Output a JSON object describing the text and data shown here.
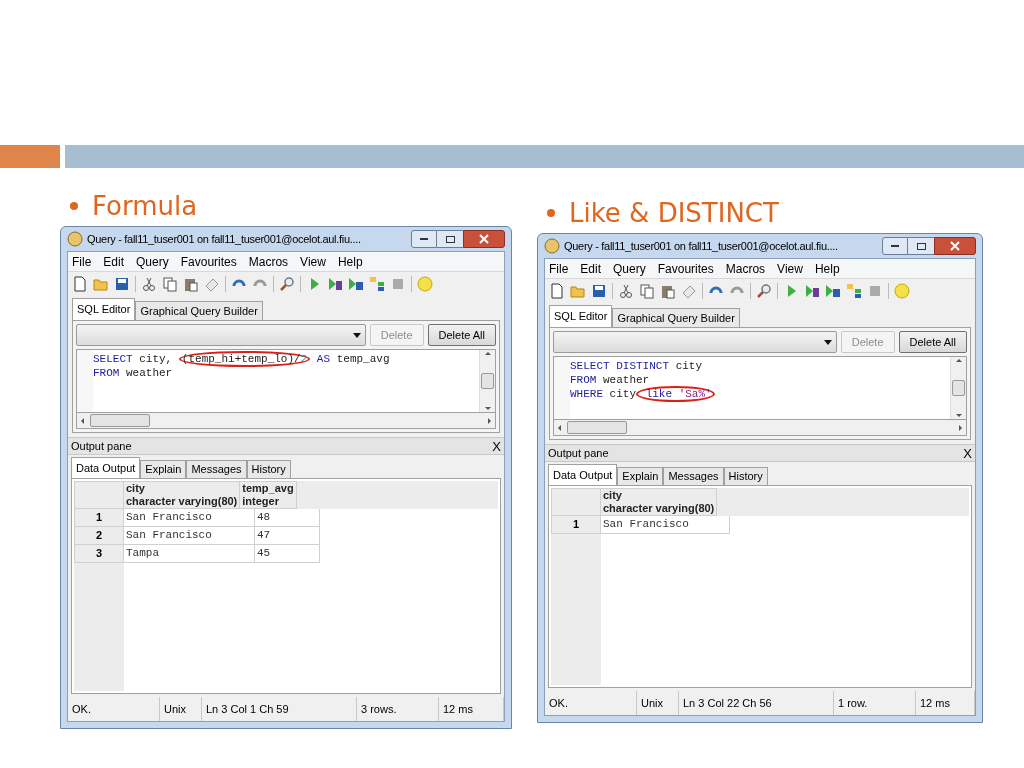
{
  "slide": {
    "panels": [
      {
        "bullet": "Formula",
        "window": {
          "title": "Query - fall11_tuser001 on fall11_tuser001@ocelot.aul.fiu....",
          "menu": [
            "File",
            "Edit",
            "Query",
            "Favourites",
            "Macros",
            "View",
            "Help"
          ],
          "editor_tabs": [
            {
              "label": "SQL Editor",
              "selected": true
            },
            {
              "label": "Graphical Query Builder",
              "selected": false
            }
          ],
          "buttons": [
            {
              "label": "Delete",
              "disabled": true
            },
            {
              "label": "Delete All",
              "disabled": false
            }
          ],
          "sql": [
            [
              {
                "text": "SELECT",
                "kind": "keyword"
              },
              {
                "text": " city, ",
                "kind": "plain"
              },
              {
                "text": "(temp_hi+temp_lo)/",
                "kind": "plain",
                "circled": true
              },
              {
                "text": "2",
                "kind": "number",
                "circled": true
              },
              {
                "text": " AS",
                "kind": "keyword"
              },
              {
                "text": " temp_avg",
                "kind": "plain"
              }
            ],
            [
              {
                "text": "FROM",
                "kind": "keyword"
              },
              {
                "text": " weather",
                "kind": "plain"
              }
            ]
          ],
          "output": {
            "title": "Output pane",
            "close": "X",
            "tabs": [
              {
                "label": "Data Output",
                "selected": true
              },
              {
                "label": "Explain",
                "selected": false
              },
              {
                "label": "Messages",
                "selected": false
              },
              {
                "label": "History",
                "selected": false
              }
            ],
            "columns": [
              {
                "name": "city",
                "type": "character varying(80)"
              },
              {
                "name": "temp_avg",
                "type": "integer"
              }
            ],
            "rows": [
              {
                "num": "1",
                "cells": [
                  "San Francisco",
                  "48"
                ]
              },
              {
                "num": "2",
                "cells": [
                  "San Francisco",
                  "47"
                ]
              },
              {
                "num": "3",
                "cells": [
                  "Tampa",
                  "45"
                ]
              }
            ]
          },
          "status": [
            "OK.",
            "Unix",
            "Ln 3 Col 1 Ch 59",
            "3 rows.",
            "12 ms"
          ]
        }
      },
      {
        "bullet": "Like & DISTINCT",
        "window": {
          "title": "Query - fall11_tuser001 on fall11_tuser001@ocelot.aul.fiu....",
          "menu": [
            "File",
            "Edit",
            "Query",
            "Favourites",
            "Macros",
            "View",
            "Help"
          ],
          "editor_tabs": [
            {
              "label": "SQL Editor",
              "selected": true
            },
            {
              "label": "Graphical Query Builder",
              "selected": false
            }
          ],
          "buttons": [
            {
              "label": "Delete",
              "disabled": true
            },
            {
              "label": "Delete All",
              "disabled": false
            }
          ],
          "sql": [
            [
              {
                "text": "SELECT DISTINCT",
                "kind": "keyword"
              },
              {
                "text": " city",
                "kind": "plain"
              }
            ],
            [
              {
                "text": "FROM",
                "kind": "keyword"
              },
              {
                "text": " weather",
                "kind": "plain"
              }
            ],
            [
              {
                "text": "WHERE",
                "kind": "keyword"
              },
              {
                "text": " city",
                "kind": "plain"
              },
              {
                "text": " like ",
                "kind": "keyword",
                "circled": true
              },
              {
                "text": "'Sa%'",
                "kind": "string",
                "circled": true
              }
            ]
          ],
          "output": {
            "title": "Output pane",
            "close": "X",
            "tabs": [
              {
                "label": "Data Output",
                "selected": true
              },
              {
                "label": "Explain",
                "selected": false
              },
              {
                "label": "Messages",
                "selected": false
              },
              {
                "label": "History",
                "selected": false
              }
            ],
            "columns": [
              {
                "name": "city",
                "type": "character varying(80)"
              }
            ],
            "rows": [
              {
                "num": "1",
                "cells": [
                  "San Francisco"
                ]
              }
            ]
          },
          "status": [
            "OK.",
            "Unix",
            "Ln 3 Col 22 Ch 56",
            "1 row.",
            "12 ms"
          ]
        }
      }
    ]
  }
}
